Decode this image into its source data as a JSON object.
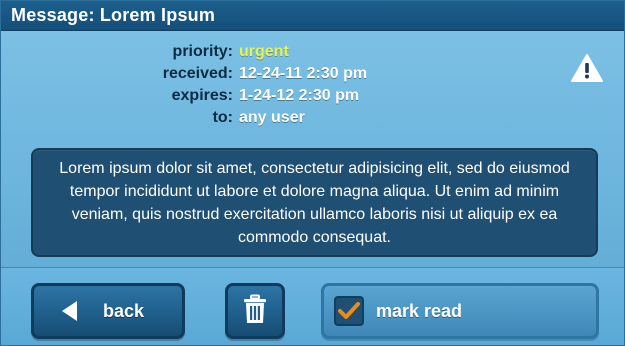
{
  "header": {
    "title": "Message: Lorem Ipsum"
  },
  "meta": {
    "priority_label": "priority:",
    "priority_value": "urgent",
    "received_label": "received:",
    "received_value": "12-24-11 2:30 pm",
    "expires_label": "expires:",
    "expires_value": "1-24-12 2:30 pm",
    "to_label": "to:",
    "to_value": "any user"
  },
  "message": {
    "body": "Lorem ipsum dolor sit amet, consectetur adipisicing elit, sed do eiusmod tempor incididunt ut labore et dolore magna aliqua. Ut enim ad minim veniam, quis nostrud exercitation ullamco laboris nisi ut aliquip ex ea commodo consequat."
  },
  "actions": {
    "back_label": "back",
    "mark_read_label": "mark read",
    "mark_read_checked": true
  },
  "icons": {
    "warning": "warning-icon",
    "back_arrow": "arrow-left-icon",
    "trash": "trash-icon",
    "check": "checkmark-icon"
  },
  "colors": {
    "titlebar": "#154f79",
    "screen_bg": "#6fb7de",
    "message_box": "#1f4f72",
    "urgent": "#e9f24a",
    "check": "#f08a16"
  }
}
